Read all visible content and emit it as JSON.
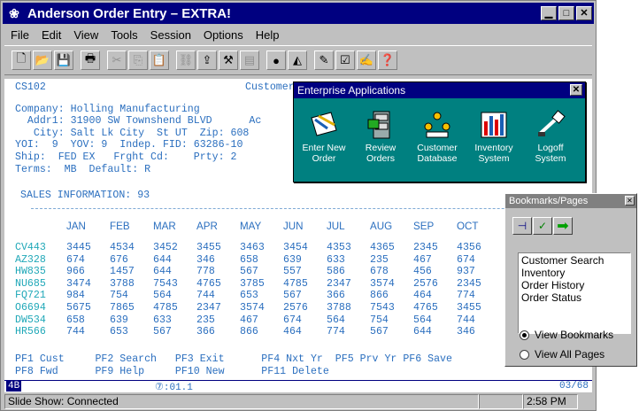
{
  "window": {
    "title": "Anderson Order Entry – EXTRA!",
    "app_icon": "flower-icon"
  },
  "menu": [
    "File",
    "Edit",
    "View",
    "Tools",
    "Session",
    "Options",
    "Help"
  ],
  "screen": {
    "line1a": "CS102",
    "line1b": "Customer S",
    "company": "Company: Holling Manufacturing",
    "addr": "  Addr1: 31900 SW Townshend BLVD      Ac",
    "city": "   City: Salt Lk City  St UT  Zip: 608",
    "yoi": "YOI:  9  YOV: 9  Indep. FID: 63286-10",
    "ship": "Ship:  FED EX   Frght Cd:    Prty: 2",
    "terms": "Terms:  MB  Default: R",
    "sales": "SALES INFORMATION: 93",
    "months": [
      "JAN",
      "FEB",
      "MAR",
      "APR",
      "MAY",
      "JUN",
      "JUL",
      "AUG",
      "SEP",
      "OCT"
    ],
    "rows": [
      {
        "code": "CV443",
        "vals": [
          "3445",
          "4534",
          "3452",
          "3455",
          "3463",
          "3454",
          "4353",
          "4365",
          "2345",
          "4356"
        ]
      },
      {
        "code": "AZ328",
        "vals": [
          "674",
          "676",
          "644",
          "346",
          "658",
          "639",
          "633",
          "235",
          "467",
          "674"
        ]
      },
      {
        "code": "HW835",
        "vals": [
          "966",
          "1457",
          "644",
          "778",
          "567",
          "557",
          "586",
          "678",
          "456",
          "937"
        ]
      },
      {
        "code": "NU685",
        "vals": [
          "3474",
          "3788",
          "7543",
          "4765",
          "3785",
          "4785",
          "2347",
          "3574",
          "2576",
          "2345"
        ]
      },
      {
        "code": "FQ721",
        "vals": [
          "984",
          "754",
          "564",
          "744",
          "653",
          "567",
          "366",
          "866",
          "464",
          "774"
        ]
      },
      {
        "code": "O6694",
        "vals": [
          "5675",
          "7865",
          "4785",
          "2347",
          "3574",
          "2576",
          "3788",
          "7543",
          "4765",
          "3455"
        ]
      },
      {
        "code": "DW534",
        "vals": [
          "658",
          "639",
          "633",
          "235",
          "467",
          "674",
          "564",
          "754",
          "564",
          "744"
        ]
      },
      {
        "code": "HR566",
        "vals": [
          "744",
          "653",
          "567",
          "366",
          "866",
          "464",
          "774",
          "567",
          "644",
          "346"
        ]
      }
    ],
    "pf1": "PF1 Cust     PF2 Search   PF3 Exit      PF4 Nxt Yr  PF5 Prv Yr PF6 Save",
    "pf2": "PF8 Fwd      PF9 Help     PF10 New      PF11 Delete",
    "status_left": "4B",
    "status_mid": "⑦:01.1",
    "status_right": "03/68"
  },
  "statusbar": {
    "text": "Slide Show: Connected",
    "time": "2:58 PM"
  },
  "enterprise": {
    "title": "Enterprise Applications",
    "apps": [
      {
        "label1": "Enter New",
        "label2": "Order",
        "icon": "enter-order-icon"
      },
      {
        "label1": "Review",
        "label2": "Orders",
        "icon": "review-orders-icon"
      },
      {
        "label1": "Customer",
        "label2": "Database",
        "icon": "customer-database-icon"
      },
      {
        "label1": "Inventory",
        "label2": "System",
        "icon": "inventory-icon"
      },
      {
        "label1": "Logoff",
        "label2": "System",
        "icon": "logoff-icon"
      }
    ]
  },
  "bookmarks": {
    "title": "Bookmarks/Pages",
    "items": [
      "Customer Search",
      "Inventory",
      "Order History",
      "Order Status"
    ],
    "radio1": "View Bookmarks",
    "radio2": "View All Pages"
  }
}
